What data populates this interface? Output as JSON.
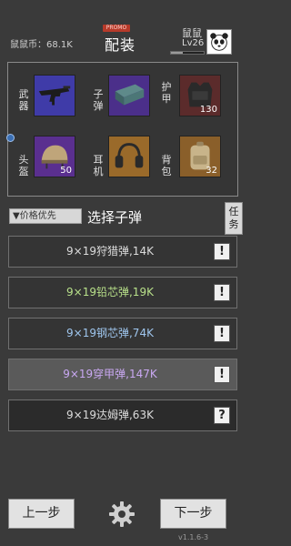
{
  "header": {
    "currency": "鼠鼠币：68.1K",
    "title_badge": "PROMO",
    "title": "配装",
    "player_name": "鼠鼠",
    "player_level": "Lv26",
    "xp_fraction": 0.35,
    "avatar_icon": "panda-icon"
  },
  "equipment": [
    {
      "label": "武器",
      "icon": "rifle-icon",
      "count": ""
    },
    {
      "label": "子弹",
      "icon": "ammo-box-icon",
      "count": ""
    },
    {
      "label": "护甲",
      "icon": "armor-vest-icon",
      "count": "130"
    },
    {
      "label": "头盔",
      "icon": "helmet-icon",
      "count": "50"
    },
    {
      "label": "耳机",
      "icon": "headset-icon",
      "count": ""
    },
    {
      "label": "背包",
      "icon": "backpack-icon",
      "count": "32"
    }
  ],
  "ammo_section": {
    "sort_label": "▼价格优先",
    "title": "选择子弹",
    "task_label": "任务"
  },
  "ammo": [
    {
      "name": "9×19狩猎弹,14K",
      "color": "#dcdcdc",
      "bg": "#343434",
      "info": "!"
    },
    {
      "name": "9×19铅芯弹,19K",
      "color": "#b8e08a",
      "bg": "#343434",
      "info": "!"
    },
    {
      "name": "9×19钢芯弹,74K",
      "color": "#9fc6ee",
      "bg": "#343434",
      "info": "!"
    },
    {
      "name": "9×19穿甲弹,147K",
      "color": "#c9a8f2",
      "bg": "#5a5a5a",
      "info": "!"
    },
    {
      "name": "9×19达姆弹,63K",
      "color": "#dcdcdc",
      "bg": "#2b2b2b",
      "info": "?"
    }
  ],
  "footer": {
    "prev_label": "上一步",
    "next_label": "下一步",
    "version": "v1.1.6-3"
  }
}
